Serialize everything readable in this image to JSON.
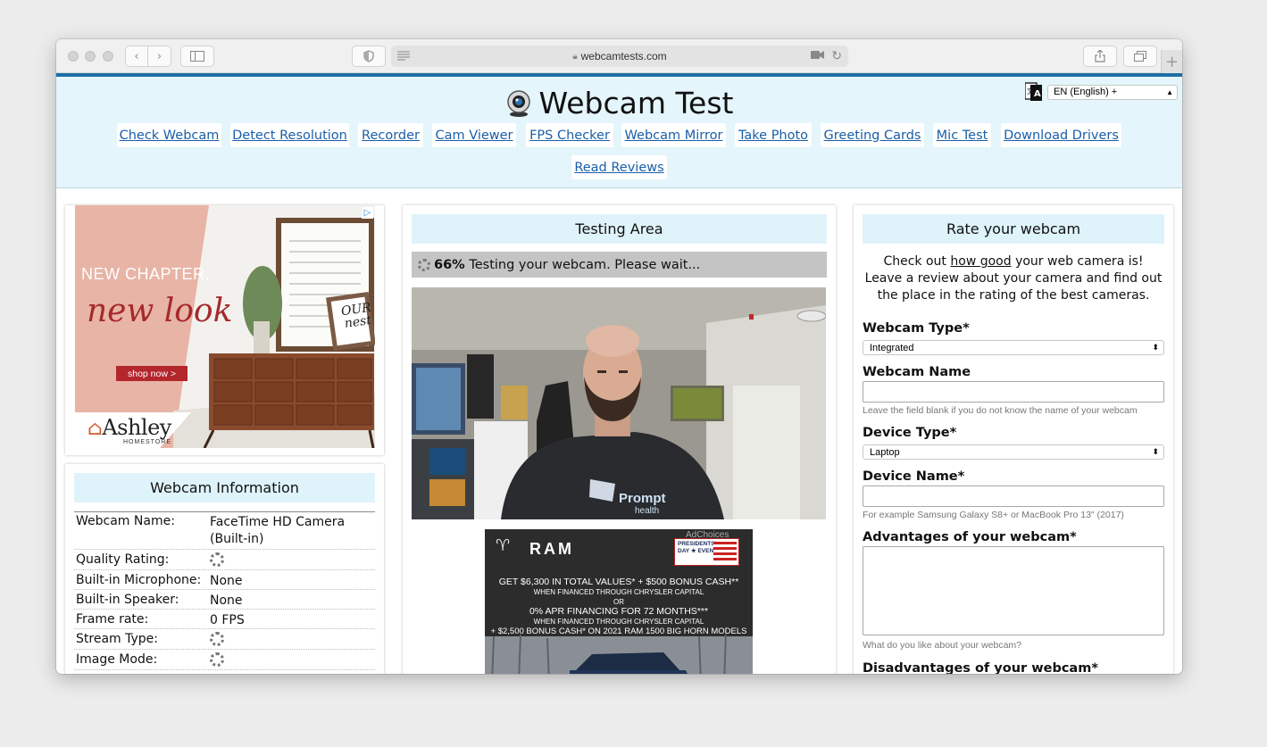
{
  "browser": {
    "url": "webcamtests.com"
  },
  "header": {
    "title": "Webcam Test",
    "language": "EN (English) +",
    "nav": [
      "Check Webcam",
      "Detect Resolution",
      "Recorder",
      "Cam Viewer",
      "FPS Checker",
      "Webcam Mirror",
      "Take Photo",
      "Greeting Cards",
      "Mic Test",
      "Download Drivers",
      "Read Reviews"
    ]
  },
  "ad_left": {
    "headline1": "NEW CHAPTER,",
    "headline2": "new look",
    "cta": "shop now >",
    "brand": "Ashley",
    "brand_sub": "HOMESTORE",
    "sign1": "OUR",
    "sign2": "nest"
  },
  "webcam_info": {
    "title": "Webcam Information",
    "rows": [
      {
        "label": "Webcam Name:",
        "value": "FaceTime HD Camera (Built-in)"
      },
      {
        "label": "Quality Rating:",
        "value": ""
      },
      {
        "label": "Built-in Microphone:",
        "value": "None"
      },
      {
        "label": "Built-in Speaker:",
        "value": "None"
      },
      {
        "label": "Frame rate:",
        "value": "0 FPS"
      },
      {
        "label": "Stream Type:",
        "value": ""
      },
      {
        "label": "Image Mode:",
        "value": ""
      }
    ]
  },
  "testing": {
    "title": "Testing Area",
    "progress_percent": "66%",
    "progress_text": "Testing your webcam. Please wait...",
    "shirt_text1": "Prompt",
    "shirt_text2": "health"
  },
  "ad_center": {
    "adchoices": "AdChoices",
    "brand": "RAM",
    "badge1": "PRESIDENTS'",
    "badge2": "DAY ★ EVENT",
    "line1": "GET $6,300 IN TOTAL VALUES* + $500 BONUS CASH**",
    "line2": "WHEN FINANCED THROUGH CHRYSLER CAPITAL",
    "line3": "OR",
    "line4": "0% APR FINANCING FOR 72 MONTHS***",
    "line5": "WHEN FINANCED THROUGH CHRYSLER CAPITAL",
    "line6": "+ $2,500 BONUS CASH* ON 2021 RAM 1500 BIG HORN MODELS"
  },
  "rate": {
    "title": "Rate your webcam",
    "intro_prefix": "Check out ",
    "intro_link": "how good",
    "intro_suffix": " your web camera is!",
    "intro_rest": "Leave a review about your camera and find out the place in the rating of the best cameras.",
    "webcam_type_label": "Webcam Type*",
    "webcam_type_value": "Integrated",
    "webcam_name_label": "Webcam Name",
    "webcam_name_hint": "Leave the field blank if you do not know the name of your webcam",
    "device_type_label": "Device Type*",
    "device_type_value": "Laptop",
    "device_name_label": "Device Name*",
    "device_name_hint": "For example Samsung Galaxy S8+ or MacBook Pro 13\" (2017)",
    "advantages_label": "Advantages of your webcam*",
    "advantages_hint": "What do you like about your webcam?",
    "disadvantages_label": "Disadvantages of your webcam*"
  },
  "colors": {
    "header_bg": "#e4f5fb",
    "link": "#1a5fa8",
    "accent_line": "#1d6fa5",
    "card_title_bg": "#dff3fa"
  }
}
